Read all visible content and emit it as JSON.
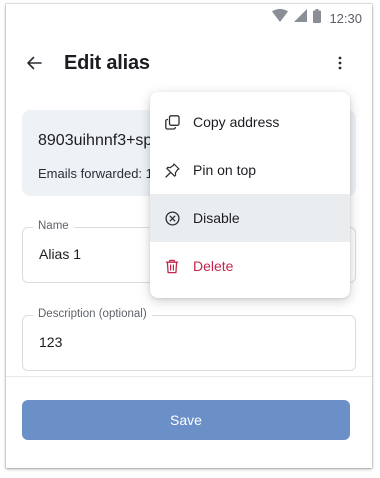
{
  "status_bar": {
    "time": "12:30"
  },
  "top_bar": {
    "title": "Edit alias"
  },
  "alias": {
    "address": "8903uihnnf3+sp",
    "forwarded_text": "Emails forwarded: 1"
  },
  "fields": {
    "name": {
      "label": "Name",
      "value": "Alias 1"
    },
    "description": {
      "label": "Description (optional)",
      "value": "123"
    }
  },
  "actions": {
    "save_label": "Save"
  },
  "menu": {
    "items": [
      {
        "label": "Copy address",
        "icon": "copy-icon"
      },
      {
        "label": "Pin on top",
        "icon": "pin-icon"
      },
      {
        "label": "Disable",
        "icon": "disable-icon"
      },
      {
        "label": "Delete",
        "icon": "trash-icon"
      }
    ]
  },
  "colors": {
    "accent": "#6b8fc7",
    "danger": "#c2264d",
    "card_background": "#eef2f6",
    "selected_item": "#e9edf0"
  }
}
